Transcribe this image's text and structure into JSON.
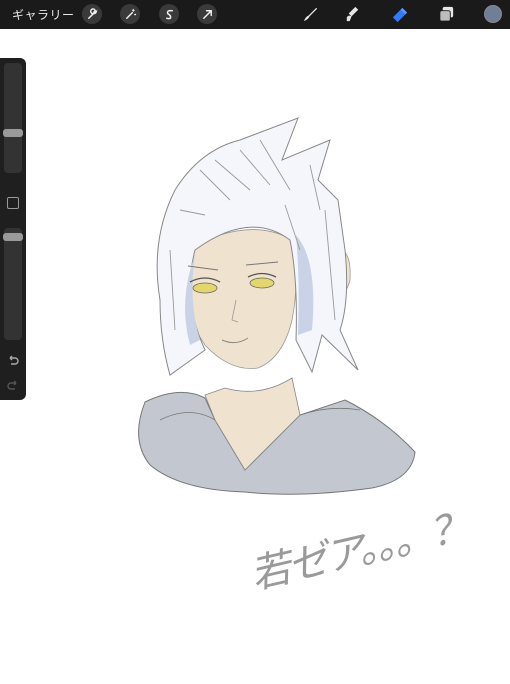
{
  "toolbar": {
    "gallery_label": "ギャラリー",
    "left_tools": [
      "wrench-icon",
      "magic-wand-icon",
      "selection-s-icon",
      "transform-arrow-icon"
    ],
    "right_tools": [
      "brush-icon",
      "smudge-icon",
      "eraser-icon",
      "layers-icon"
    ],
    "active_tool": "eraser",
    "current_color": "#6f7f97"
  },
  "sidebar": {
    "brush_size": 0.35,
    "opacity": 0.95,
    "controls": [
      "modify-button",
      "undo-icon",
      "redo-icon"
    ]
  },
  "canvas": {
    "handwritten_caption": "若ゼア。。。？"
  },
  "colors": {
    "accent": "#2f7bf6",
    "topbar": "#1a1a1a",
    "hair_shadow": "#c9d2e6",
    "skin": "#efe2cf",
    "eyes": "#e4d76a",
    "hood": "#c3c7cf"
  }
}
